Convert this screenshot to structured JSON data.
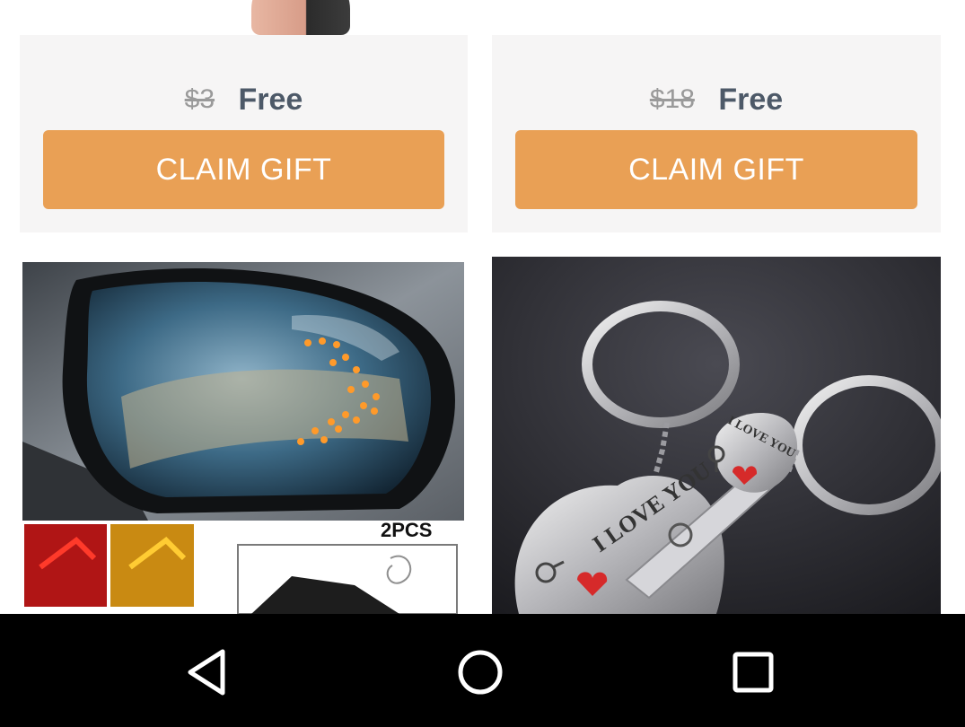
{
  "offers": [
    {
      "original_price": "$3",
      "price": "Free",
      "button_label": "CLAIM GIFT"
    },
    {
      "original_price": "$18",
      "price": "Free",
      "button_label": "CLAIM GIFT"
    }
  ],
  "products": [
    {
      "image_text": "2PCS",
      "swatch_labels": [
        "RED",
        "YELLOW"
      ]
    },
    {
      "image_text_1": "I LOVE YOU",
      "image_text_2": "I LOVE YOU"
    }
  ],
  "navigation": {
    "back_icon": "back-triangle-icon",
    "home_icon": "home-circle-icon",
    "recents_icon": "recents-square-icon"
  },
  "colors": {
    "button": "#e9a055",
    "card_background": "#f6f5f5",
    "price": "#4d5968",
    "nav_bar": "#000000"
  }
}
